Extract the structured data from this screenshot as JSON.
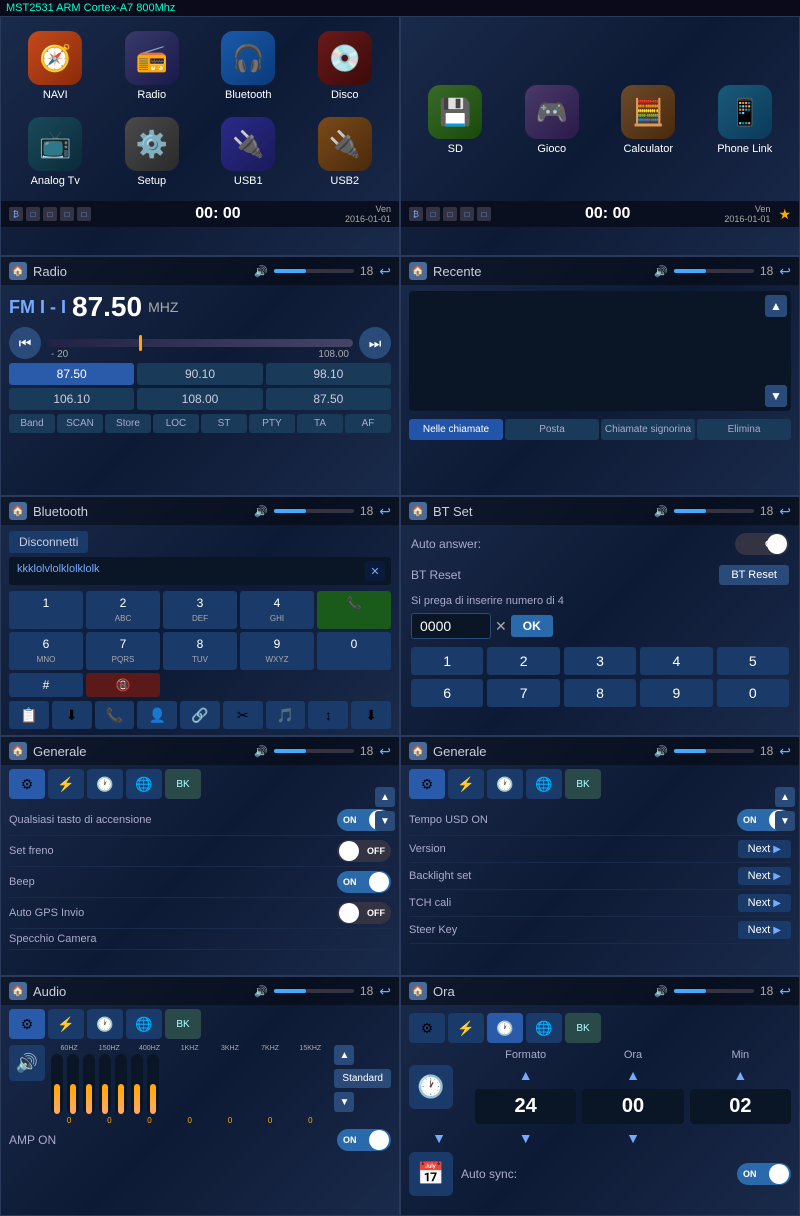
{
  "header": {
    "title": "MST2531 ARM Cortex-A7 800Mhz"
  },
  "panel1": {
    "apps": [
      {
        "label": "NAVI",
        "icon": "🧭",
        "color": "#c44a1a"
      },
      {
        "label": "Radio",
        "icon": "📻",
        "color": "#3a3a5a"
      },
      {
        "label": "Bluetooth",
        "icon": "🎧",
        "color": "#1a4a8a"
      },
      {
        "label": "Disco",
        "icon": "💿",
        "color": "#4a1a1a"
      },
      {
        "label": "Analog Tv",
        "icon": "📺",
        "color": "#1a3a5a"
      },
      {
        "label": "Setup",
        "icon": "⚙️",
        "color": "#3a4a3a"
      },
      {
        "label": "USB1",
        "icon": "🔌",
        "color": "#3a3a7a"
      },
      {
        "label": "USB2",
        "icon": "🔌",
        "color": "#5a3a1a"
      }
    ],
    "status": {
      "time": "00: 00",
      "date": "Ven\n2016-01-01"
    }
  },
  "panel2": {
    "apps": [
      {
        "label": "SD",
        "icon": "💾",
        "color": "#2a4a2a"
      },
      {
        "label": "Gioco",
        "icon": "🎮",
        "color": "#3a3a5a"
      },
      {
        "label": "Calculator",
        "icon": "🧮",
        "color": "#4a3a1a"
      },
      {
        "label": "Phone Link",
        "icon": "📱",
        "color": "#1a4a6a"
      }
    ],
    "status": {
      "time": "00: 00",
      "date": "Ven\n2016-01-01"
    }
  },
  "panel3": {
    "title": "Radio",
    "vol_indicator": "🔊",
    "num": "18",
    "band": "FM I - I",
    "freq": "87.50",
    "unit": "MHZ",
    "slider_min": "- 20",
    "slider_max": "108.00",
    "freq_buttons": [
      "87.50",
      "90.10",
      "98.10",
      "106.10",
      "108.00",
      "87.50"
    ],
    "controls": [
      "Band",
      "SCAN",
      "Store",
      "LOC",
      "ST",
      "PTY",
      "TA",
      "AF"
    ]
  },
  "panel4": {
    "title": "Recente",
    "vol_indicator": "🔊",
    "num": "18",
    "tabs": [
      "Nelle chiamate",
      "Posta",
      "Chiamate signorina",
      "Elimina"
    ]
  },
  "panel5": {
    "title": "Bluetooth",
    "vol_indicator": "🔊",
    "num": "18",
    "disconnect_label": "Disconnetti",
    "device_id": "kkklolvlolklolklolk",
    "numpad": [
      "1",
      "2",
      "3",
      "4",
      "☎",
      "6",
      "7",
      "8",
      "9",
      "0",
      "#",
      "📞"
    ],
    "numpad_rows": [
      [
        "1",
        "2",
        "3",
        "4",
        "☎"
      ],
      [
        "6",
        "7",
        "8",
        "9",
        "0"
      ],
      [
        "#",
        "📞"
      ]
    ]
  },
  "panel6": {
    "title": "BT Set",
    "vol_indicator": "🔊",
    "num": "18",
    "auto_answer_label": "Auto answer:",
    "auto_answer_value": "OFF",
    "bt_reset_label": "BT Reset",
    "bt_reset_btn": "BT Reset",
    "hint": "Si prega di inserire numero di 4",
    "pin_value": "0000",
    "ok_label": "OK",
    "numgrid": [
      "1",
      "2",
      "3",
      "4",
      "5",
      "6",
      "7",
      "8",
      "9",
      "0"
    ]
  },
  "panel7": {
    "title": "Generale",
    "vol_indicator": "🔊",
    "num": "18",
    "settings": [
      {
        "label": "Qualsiasi tasto di accensione",
        "value": "ON",
        "type": "toggle-on"
      },
      {
        "label": "Set freno",
        "value": "OFF",
        "type": "toggle-off"
      },
      {
        "label": "Beep",
        "value": "ON",
        "type": "toggle-on"
      },
      {
        "label": "Auto GPS Invio",
        "value": "OFF",
        "type": "toggle-off"
      },
      {
        "label": "Specchio Camera",
        "value": "",
        "type": "none"
      }
    ]
  },
  "panel8": {
    "title": "Generale",
    "vol_indicator": "🔊",
    "num": "18",
    "settings": [
      {
        "label": "Tempo USD ON",
        "value": "ON",
        "type": "toggle-on"
      },
      {
        "label": "Version",
        "value": "Next",
        "type": "next"
      },
      {
        "label": "Backlight set",
        "value": "Next",
        "type": "next"
      },
      {
        "label": "TCH cali",
        "value": "Next",
        "type": "next"
      },
      {
        "label": "Steer Key",
        "value": "Next",
        "type": "next"
      }
    ]
  },
  "panel9": {
    "title": "Audio",
    "vol_indicator": "🔊",
    "num": "18",
    "eq_freqs": [
      "60HZ",
      "150HZ",
      "400HZ",
      "1KHZ",
      "3KHZ",
      "7KHZ",
      "15KHZ"
    ],
    "eq_values": [
      0,
      0,
      0,
      0,
      0,
      0,
      0
    ],
    "preset_label": "Standard",
    "amp_label": "AMP ON",
    "amp_value": "ON"
  },
  "panel10": {
    "title": "Ora",
    "vol_indicator": "🔊",
    "num": "18",
    "formato_label": "Formato",
    "ora_label": "Ora",
    "min_label": "Min",
    "formato_value": "24",
    "ora_value": "00",
    "min_value": "02",
    "autosync_label": "Auto sync:",
    "autosync_value": "ON"
  }
}
